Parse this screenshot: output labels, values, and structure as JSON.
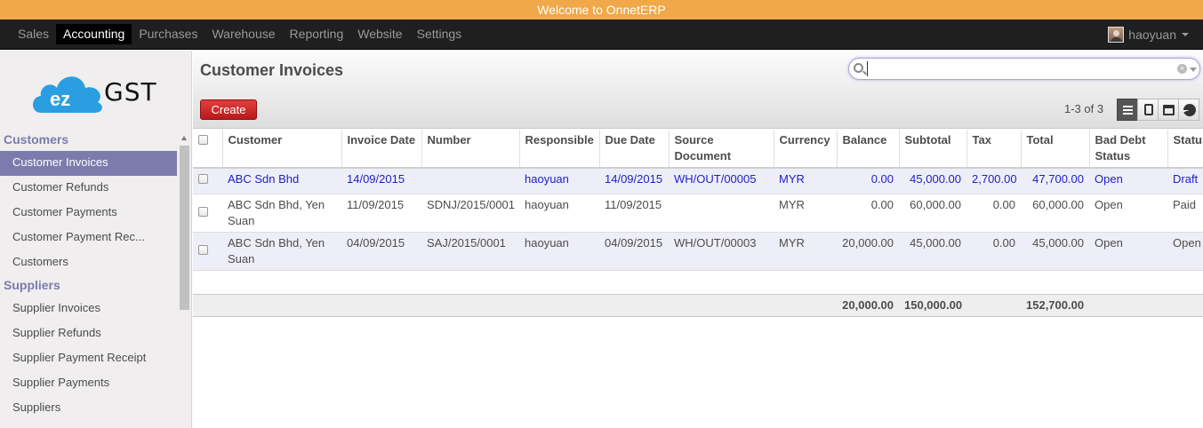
{
  "banner": "Welcome to OnnetERP",
  "menu": [
    "Sales",
    "Accounting",
    "Purchases",
    "Warehouse",
    "Reporting",
    "Website",
    "Settings"
  ],
  "user": {
    "name": "haoyuan"
  },
  "logo": {
    "text": "GST",
    "cloud_text": "ez"
  },
  "sidebar": {
    "sections": [
      {
        "title": "Customers",
        "items": [
          "Customer Invoices",
          "Customer Refunds",
          "Customer Payments",
          "Customer Payment Rec...",
          "Customers"
        ]
      },
      {
        "title": "Suppliers",
        "items": [
          "Supplier Invoices",
          "Supplier Refunds",
          "Supplier Payment Receipt",
          "Supplier Payments",
          "Suppliers"
        ]
      }
    ],
    "active": "Customer Invoices"
  },
  "page": {
    "title": "Customer Invoices",
    "create_label": "Create",
    "search_value": "",
    "pager": "1-3 of 3"
  },
  "table": {
    "headers": [
      "Customer",
      "Invoice Date",
      "Number",
      "Responsible",
      "Due Date",
      "Source Document",
      "Currency",
      "Balance",
      "Subtotal",
      "Tax",
      "Total",
      "Bad Debt Status",
      "Status"
    ],
    "rows": [
      [
        "ABC Sdn Bhd",
        "14/09/2015",
        "",
        "haoyuan",
        "14/09/2015",
        "WH/OUT/00005",
        "MYR",
        "0.00",
        "45,000.00",
        "2,700.00",
        "47,700.00",
        "Open",
        "Draft"
      ],
      [
        "ABC Sdn Bhd, Yen Suan",
        "11/09/2015",
        "SDNJ/2015/0001",
        "haoyuan",
        "11/09/2015",
        "",
        "MYR",
        "0.00",
        "60,000.00",
        "0.00",
        "60,000.00",
        "Open",
        "Paid"
      ],
      [
        "ABC Sdn Bhd, Yen Suan",
        "04/09/2015",
        "SAJ/2015/0001",
        "haoyuan",
        "04/09/2015",
        "WH/OUT/00003",
        "MYR",
        "20,000.00",
        "45,000.00",
        "0.00",
        "45,000.00",
        "Open",
        "Open"
      ]
    ],
    "totals": {
      "balance": "20,000.00",
      "subtotal": "150,000.00",
      "total": "152,700.00"
    }
  },
  "colors": {
    "banner": "#f0a848",
    "accent": "#7c7bad",
    "create": "#c92a2a",
    "draft_row": "#2020c8"
  }
}
